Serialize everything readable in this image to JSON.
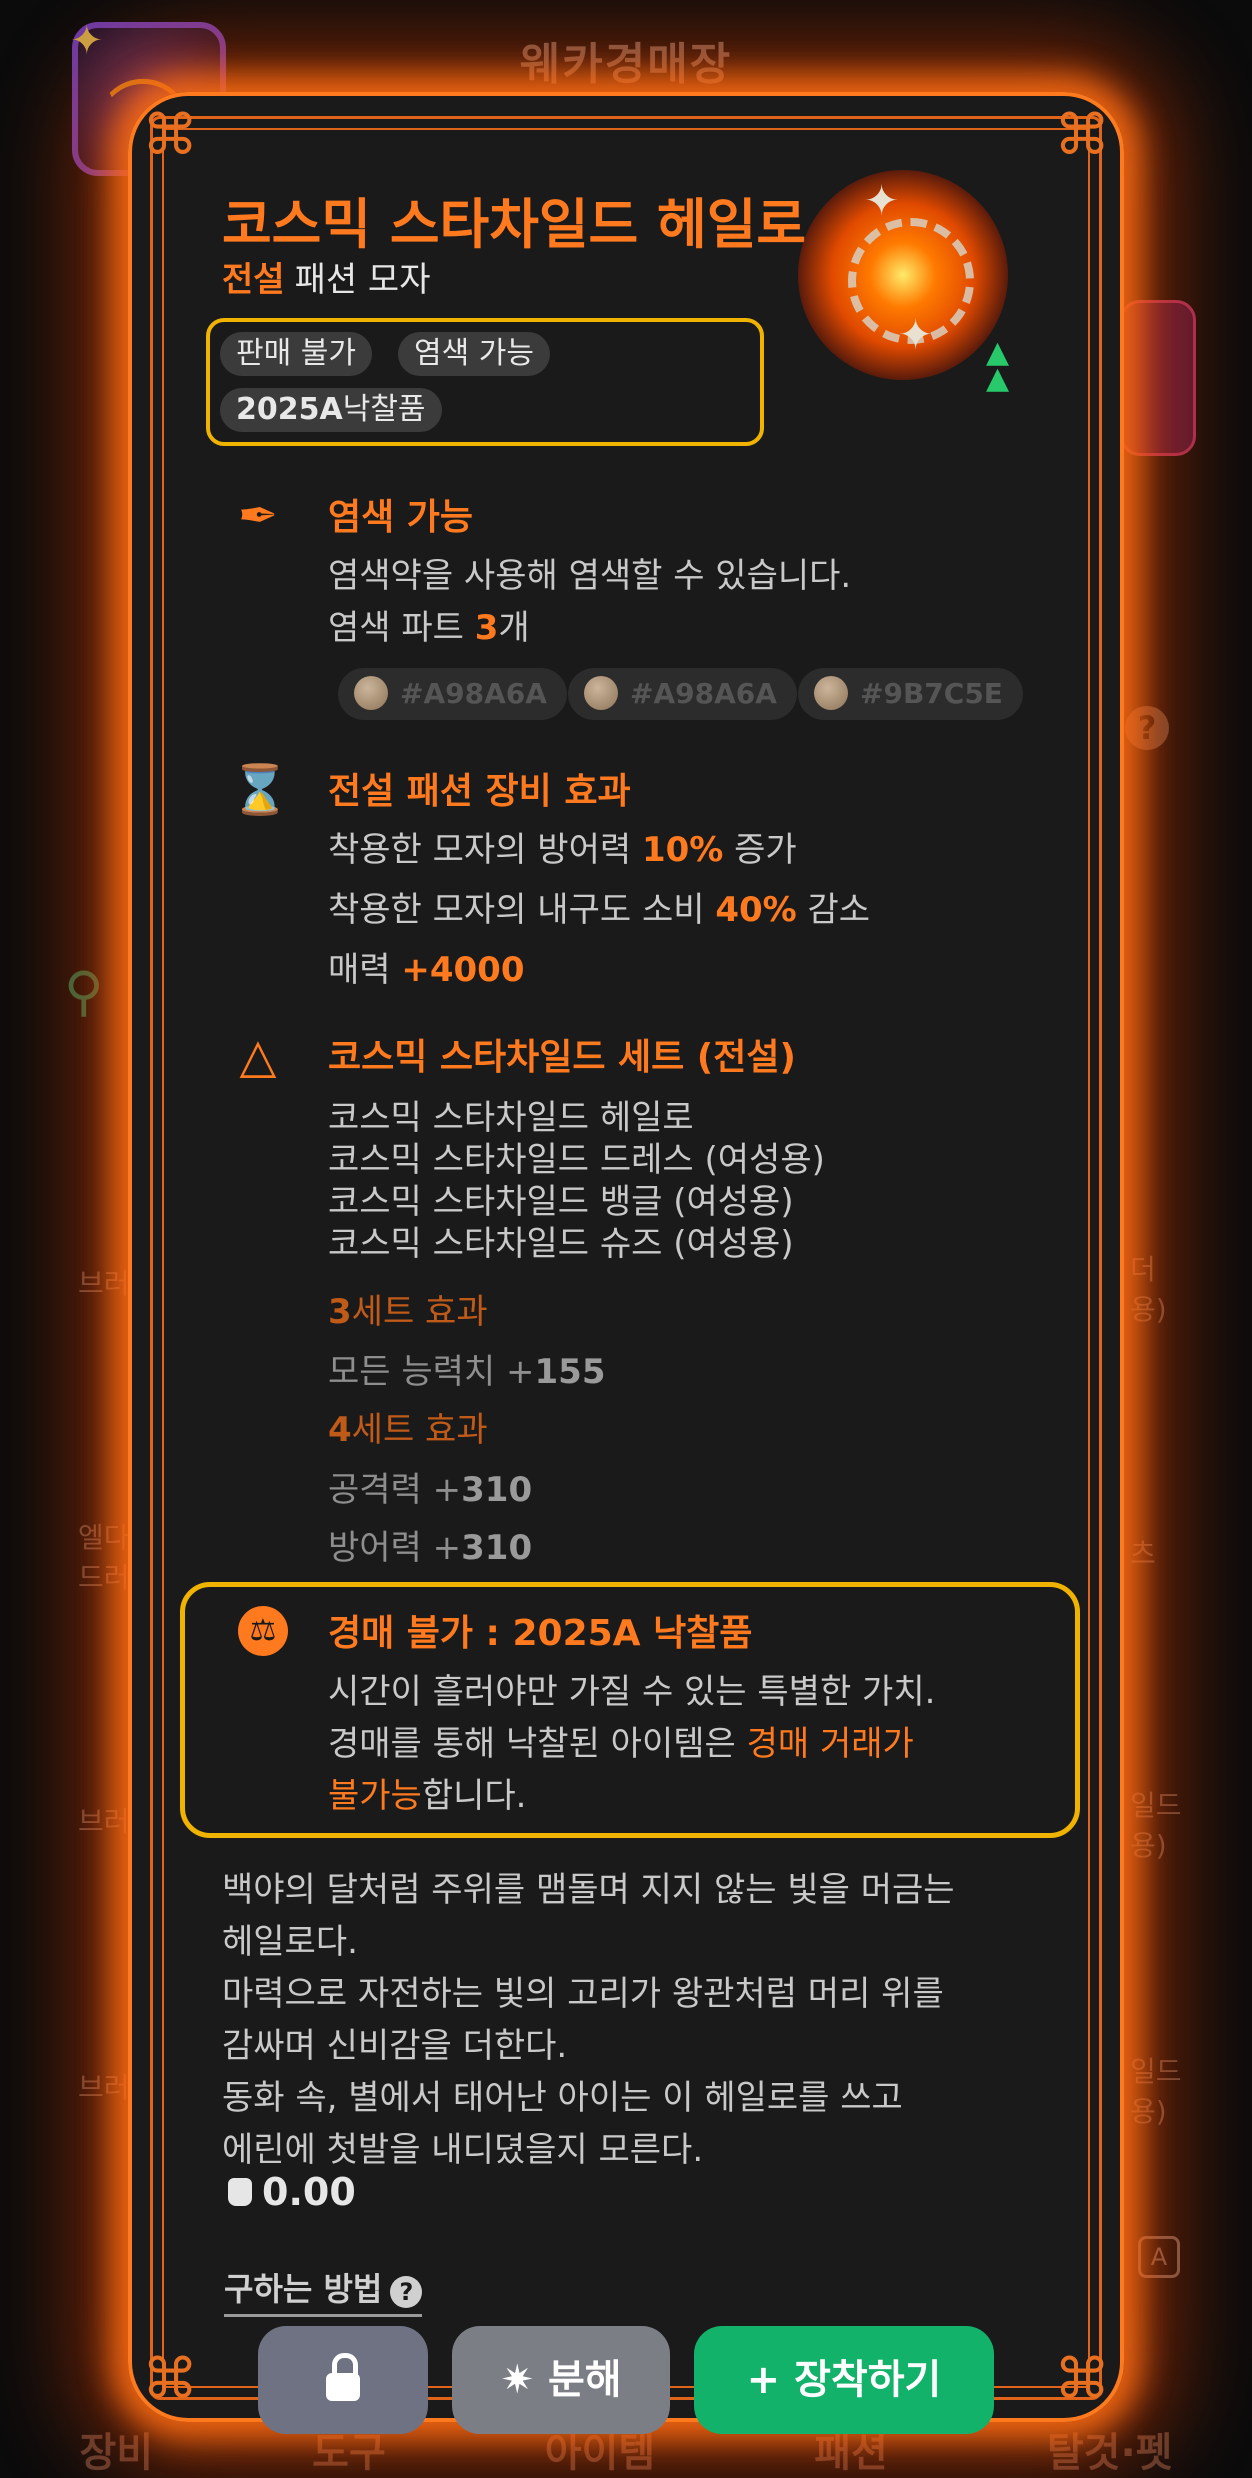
{
  "background": {
    "title": "웨카경매장",
    "bottom_tabs": [
      "장비",
      "도구",
      "아이템",
      "패션",
      "탈것·펫"
    ],
    "left_fragments": [
      "브러",
      "엘다\n드러",
      "브러",
      "브러"
    ],
    "right_fragments": [
      "더\n용)",
      "츠",
      "일드\n용)",
      "일드\n용)"
    ],
    "help_glyph": "?",
    "a_badge": "A"
  },
  "item": {
    "name": "코스믹 스타차일드 헤일로",
    "grade": "전설",
    "category": "패션 모자",
    "tags": [
      "판매 불가",
      "염색 가능"
    ],
    "auction_tag": {
      "year": "2025A",
      "label": "낙찰품"
    }
  },
  "dye": {
    "title": "염색 가능",
    "desc": "염색약을 사용해 염색할 수 있습니다.",
    "parts_prefix": "염색 파트 ",
    "parts_count": "3",
    "parts_suffix": "개",
    "colors": [
      "#A98A6A",
      "#A98A6A",
      "#9B7C5E"
    ]
  },
  "effect": {
    "title": "전설 패션 장비 효과",
    "lines": [
      {
        "pre": "착용한 모자의 방어력 ",
        "val": "10%",
        "post": " 증가"
      },
      {
        "pre": "착용한 모자의 내구도 소비 ",
        "val": "40%",
        "post": " 감소"
      },
      {
        "pre": "매력 ",
        "val": "+4000",
        "post": ""
      }
    ]
  },
  "set": {
    "title": "코스믹 스타차일드 세트 (전설)",
    "items": [
      "코스믹 스타차일드 헤일로",
      "코스믹 스타차일드 드레스 (여성용)",
      "코스믹 스타차일드 뱅글 (여성용)",
      "코스믹 스타차일드 슈즈 (여성용)"
    ],
    "bonuses": [
      {
        "count": "3",
        "label": "세트 효과",
        "stats": [
          {
            "name": "모든 능력치 +",
            "val": "155"
          }
        ]
      },
      {
        "count": "4",
        "label": "세트 효과",
        "stats": [
          {
            "name": "공격력 +",
            "val": "310"
          },
          {
            "name": "방어력 +",
            "val": "310"
          }
        ]
      }
    ]
  },
  "auction": {
    "title": "경매 불가 : 2025A 낙찰품",
    "line1": "시간이 흘러야만 가질 수 있는 특별한 가치.",
    "line2_pre": "경매를 통해 낙찰된 아이템은 ",
    "line2_hl": "경매 거래가",
    "line3_hl": "불가능",
    "line3_post": "합니다."
  },
  "description": [
    "백야의 달처럼 주위를 맴돌며 지지 않는 빛을 머금는",
    "헤일로다.",
    "마력으로 자전하는 빛의 고리가 왕관처럼 머리 위를",
    "감싸며 신비감을 더한다.",
    "동화 속, 별에서 태어난 아이는 이 헤일로를 쓰고",
    "에린에 첫발을 내디뎠을지 모른다."
  ],
  "weight": "0.00",
  "how_to_get": "구하는 방법",
  "buttons": {
    "lock_icon": "lock-icon",
    "disassemble": "분해",
    "equip": "장착하기"
  },
  "colors": {
    "accent": "#ff7a1e",
    "highlight_border": "#f0b400",
    "equip_green": "#13b26a",
    "card_bg": "#1a1a1a"
  }
}
